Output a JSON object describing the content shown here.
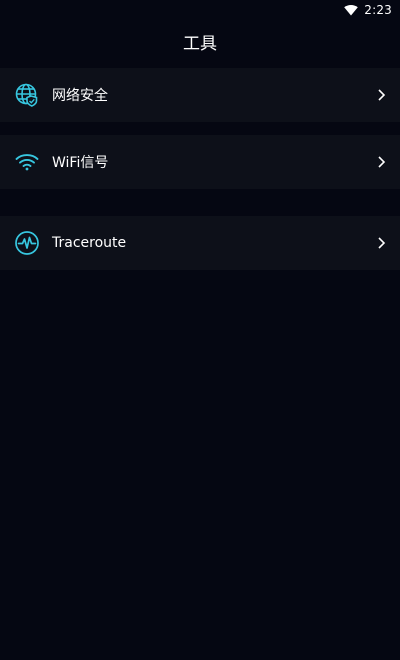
{
  "status_bar": {
    "time": "2:23",
    "wifi_icon": "wifi-full-icon"
  },
  "header": {
    "title": "工具"
  },
  "tools": {
    "items": [
      {
        "label": "网络安全",
        "icon": "globe-shield-icon"
      },
      {
        "label": "WiFi信号",
        "icon": "wifi-signal-icon"
      },
      {
        "label": "Traceroute",
        "icon": "pulse-icon"
      }
    ]
  },
  "colors": {
    "background": "#050712",
    "row_background": "#0d1019",
    "icon_accent": "#37c7e0",
    "text": "#ffffff"
  }
}
